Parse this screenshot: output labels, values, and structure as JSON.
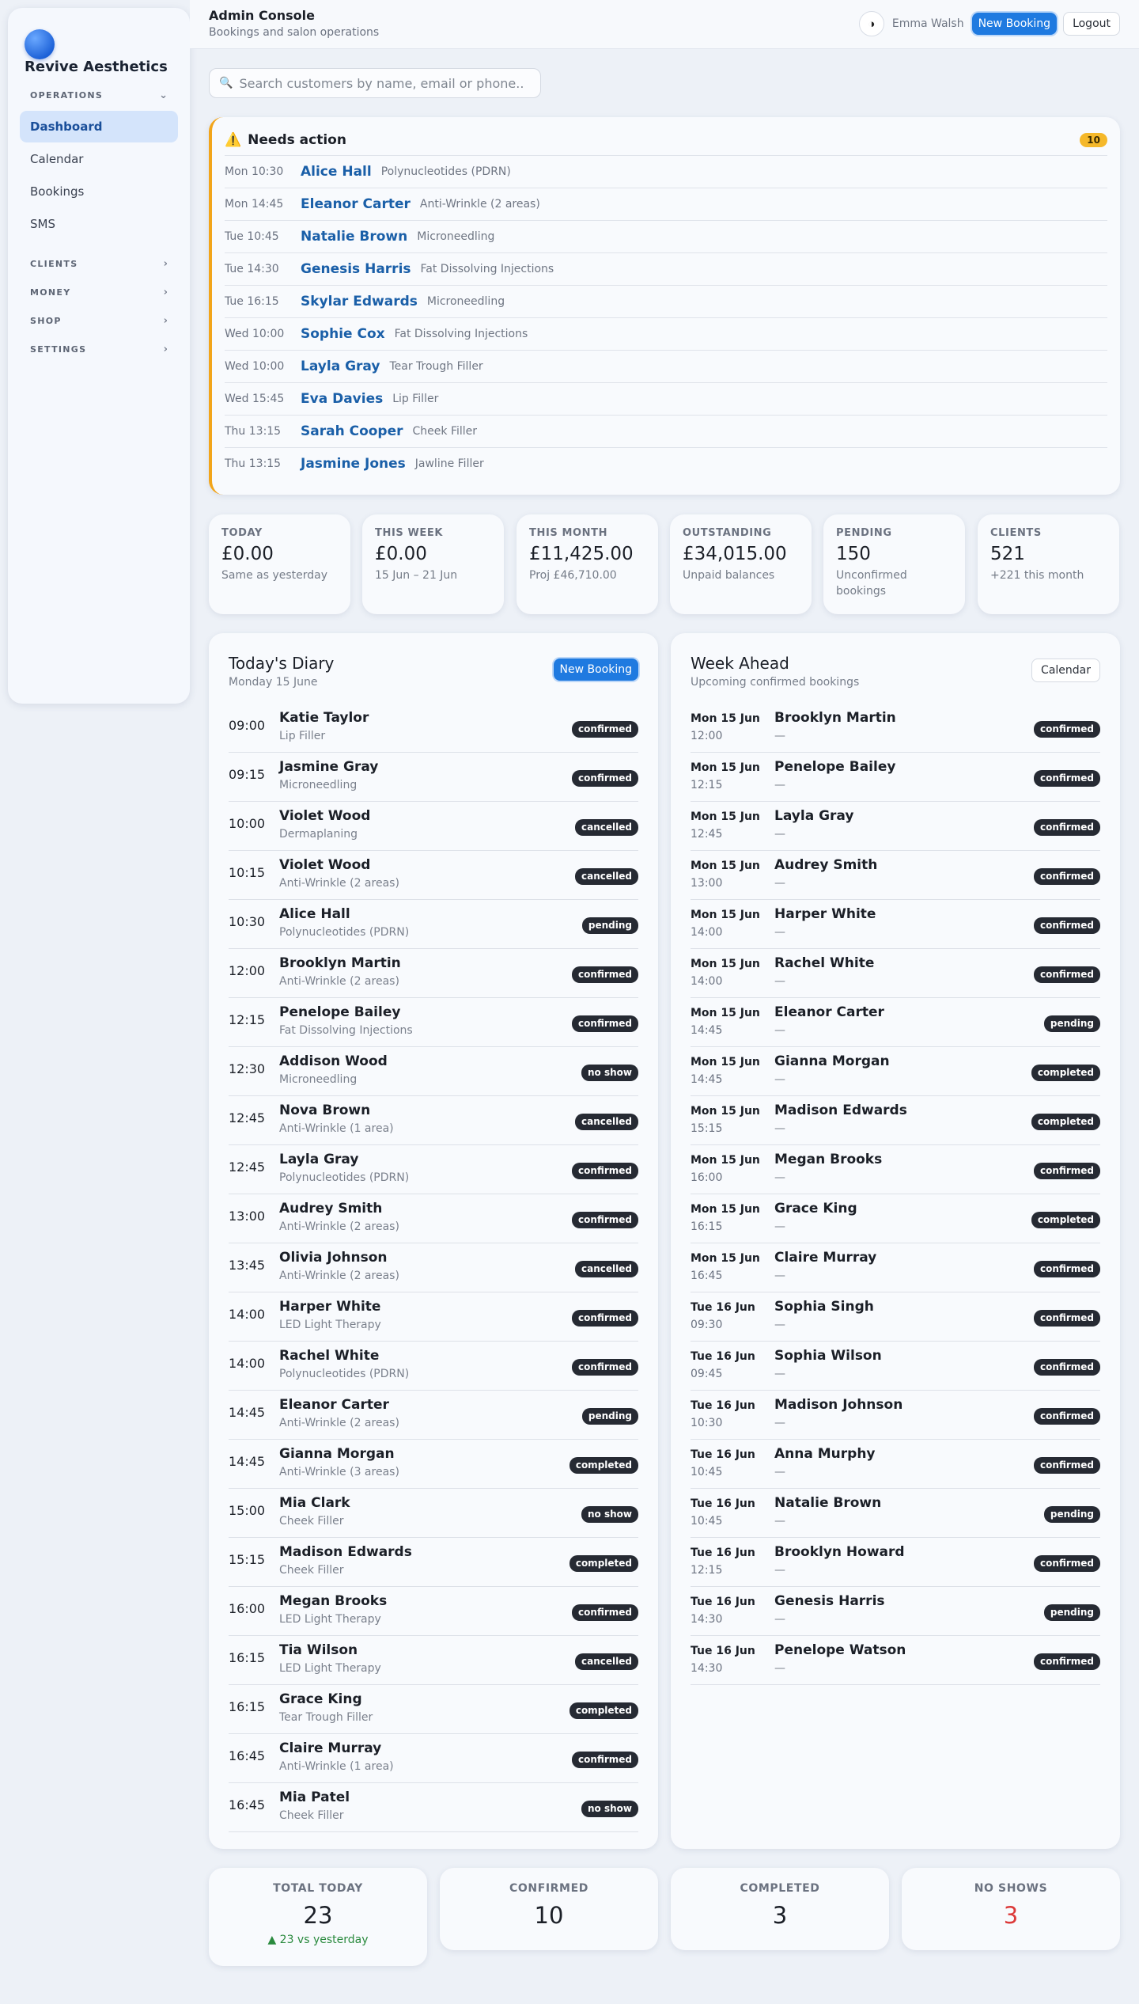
{
  "sidebar": {
    "brand": "Revive Aesthetics",
    "sections": {
      "operations": "OPERATIONS",
      "clients": "CLIENTS",
      "money": "MONEY",
      "shop": "SHOP",
      "settings": "SETTINGS"
    },
    "items": [
      {
        "label": "Dashboard",
        "active": true
      },
      {
        "label": "Calendar"
      },
      {
        "label": "Bookings"
      },
      {
        "label": "SMS"
      }
    ]
  },
  "header": {
    "title": "Admin Console",
    "subtitle": "Bookings and salon operations",
    "user": "Emma Walsh",
    "new_booking": "New Booking",
    "logout": "Logout"
  },
  "search": {
    "placeholder": "Search customers by name, email or phone..."
  },
  "needs_action": {
    "title": "Needs action",
    "count": "10",
    "items": [
      {
        "time": "Mon 10:30",
        "name": "Alice Hall",
        "service": "Polynucleotides (PDRN)"
      },
      {
        "time": "Mon 14:45",
        "name": "Eleanor Carter",
        "service": "Anti-Wrinkle (2 areas)"
      },
      {
        "time": "Tue 10:45",
        "name": "Natalie Brown",
        "service": "Microneedling"
      },
      {
        "time": "Tue 14:30",
        "name": "Genesis Harris",
        "service": "Fat Dissolving Injections"
      },
      {
        "time": "Tue 16:15",
        "name": "Skylar Edwards",
        "service": "Microneedling"
      },
      {
        "time": "Wed 10:00",
        "name": "Sophie Cox",
        "service": "Fat Dissolving Injections"
      },
      {
        "time": "Wed 10:00",
        "name": "Layla Gray",
        "service": "Tear Trough Filler"
      },
      {
        "time": "Wed 15:45",
        "name": "Eva Davies",
        "service": "Lip Filler"
      },
      {
        "time": "Thu 13:15",
        "name": "Sarah Cooper",
        "service": "Cheek Filler"
      },
      {
        "time": "Thu 13:15",
        "name": "Jasmine Jones",
        "service": "Jawline Filler"
      }
    ]
  },
  "stats": [
    {
      "label": "TODAY",
      "value": "£0.00",
      "sub": "Same as yesterday"
    },
    {
      "label": "THIS WEEK",
      "value": "£0.00",
      "sub": "15 Jun – 21 Jun"
    },
    {
      "label": "THIS MONTH",
      "value": "£11,425.00",
      "sub": "Proj £46,710.00"
    },
    {
      "label": "OUTSTANDING",
      "value": "£34,015.00",
      "sub": "Unpaid balances"
    },
    {
      "label": "PENDING",
      "value": "150",
      "sub": "Unconfirmed bookings"
    },
    {
      "label": "CLIENTS",
      "value": "521",
      "sub": "+221 this month"
    }
  ],
  "diary": {
    "title": "Today's Diary",
    "subtitle": "Monday 15 June",
    "button": "New Booking",
    "rows": [
      {
        "time": "09:00",
        "name": "Katie Taylor",
        "service": "Lip Filler",
        "status": "confirmed"
      },
      {
        "time": "09:15",
        "name": "Jasmine Gray",
        "service": "Microneedling",
        "status": "confirmed"
      },
      {
        "time": "10:00",
        "name": "Violet Wood",
        "service": "Dermaplaning",
        "status": "cancelled"
      },
      {
        "time": "10:15",
        "name": "Violet Wood",
        "service": "Anti-Wrinkle (2 areas)",
        "status": "cancelled"
      },
      {
        "time": "10:30",
        "name": "Alice Hall",
        "service": "Polynucleotides (PDRN)",
        "status": "pending"
      },
      {
        "time": "12:00",
        "name": "Brooklyn Martin",
        "service": "Anti-Wrinkle (2 areas)",
        "status": "confirmed"
      },
      {
        "time": "12:15",
        "name": "Penelope Bailey",
        "service": "Fat Dissolving Injections",
        "status": "confirmed"
      },
      {
        "time": "12:30",
        "name": "Addison Wood",
        "service": "Microneedling",
        "status": "no show"
      },
      {
        "time": "12:45",
        "name": "Nova Brown",
        "service": "Anti-Wrinkle (1 area)",
        "status": "cancelled"
      },
      {
        "time": "12:45",
        "name": "Layla Gray",
        "service": "Polynucleotides (PDRN)",
        "status": "confirmed"
      },
      {
        "time": "13:00",
        "name": "Audrey Smith",
        "service": "Anti-Wrinkle (2 areas)",
        "status": "confirmed"
      },
      {
        "time": "13:45",
        "name": "Olivia Johnson",
        "service": "Anti-Wrinkle (2 areas)",
        "status": "cancelled"
      },
      {
        "time": "14:00",
        "name": "Harper White",
        "service": "LED Light Therapy",
        "status": "confirmed"
      },
      {
        "time": "14:00",
        "name": "Rachel White",
        "service": "Polynucleotides (PDRN)",
        "status": "confirmed"
      },
      {
        "time": "14:45",
        "name": "Eleanor Carter",
        "service": "Anti-Wrinkle (2 areas)",
        "status": "pending"
      },
      {
        "time": "14:45",
        "name": "Gianna Morgan",
        "service": "Anti-Wrinkle (3 areas)",
        "status": "completed"
      },
      {
        "time": "15:00",
        "name": "Mia Clark",
        "service": "Cheek Filler",
        "status": "no show"
      },
      {
        "time": "15:15",
        "name": "Madison Edwards",
        "service": "Cheek Filler",
        "status": "completed"
      },
      {
        "time": "16:00",
        "name": "Megan Brooks",
        "service": "LED Light Therapy",
        "status": "confirmed"
      },
      {
        "time": "16:15",
        "name": "Tia Wilson",
        "service": "LED Light Therapy",
        "status": "cancelled"
      },
      {
        "time": "16:15",
        "name": "Grace King",
        "service": "Tear Trough Filler",
        "status": "completed"
      },
      {
        "time": "16:45",
        "name": "Claire Murray",
        "service": "Anti-Wrinkle (1 area)",
        "status": "confirmed"
      },
      {
        "time": "16:45",
        "name": "Mia Patel",
        "service": "Cheek Filler",
        "status": "no show"
      }
    ]
  },
  "week": {
    "title": "Week Ahead",
    "subtitle": "Upcoming confirmed bookings",
    "button": "Calendar",
    "rows": [
      {
        "date": "Mon 15 Jun",
        "time": "12:00",
        "name": "Brooklyn Martin",
        "detail": "—",
        "status": "confirmed"
      },
      {
        "date": "Mon 15 Jun",
        "time": "12:15",
        "name": "Penelope Bailey",
        "detail": "—",
        "status": "confirmed"
      },
      {
        "date": "Mon 15 Jun",
        "time": "12:45",
        "name": "Layla Gray",
        "detail": "—",
        "status": "confirmed"
      },
      {
        "date": "Mon 15 Jun",
        "time": "13:00",
        "name": "Audrey Smith",
        "detail": "—",
        "status": "confirmed"
      },
      {
        "date": "Mon 15 Jun",
        "time": "14:00",
        "name": "Harper White",
        "detail": "—",
        "status": "confirmed"
      },
      {
        "date": "Mon 15 Jun",
        "time": "14:00",
        "name": "Rachel White",
        "detail": "—",
        "status": "confirmed"
      },
      {
        "date": "Mon 15 Jun",
        "time": "14:45",
        "name": "Eleanor Carter",
        "detail": "—",
        "status": "pending"
      },
      {
        "date": "Mon 15 Jun",
        "time": "14:45",
        "name": "Gianna Morgan",
        "detail": "—",
        "status": "completed"
      },
      {
        "date": "Mon 15 Jun",
        "time": "15:15",
        "name": "Madison Edwards",
        "detail": "—",
        "status": "completed"
      },
      {
        "date": "Mon 15 Jun",
        "time": "16:00",
        "name": "Megan Brooks",
        "detail": "—",
        "status": "confirmed"
      },
      {
        "date": "Mon 15 Jun",
        "time": "16:15",
        "name": "Grace King",
        "detail": "—",
        "status": "completed"
      },
      {
        "date": "Mon 15 Jun",
        "time": "16:45",
        "name": "Claire Murray",
        "detail": "—",
        "status": "confirmed"
      },
      {
        "date": "Tue 16 Jun",
        "time": "09:30",
        "name": "Sophia Singh",
        "detail": "—",
        "status": "confirmed"
      },
      {
        "date": "Tue 16 Jun",
        "time": "09:45",
        "name": "Sophia Wilson",
        "detail": "—",
        "status": "confirmed"
      },
      {
        "date": "Tue 16 Jun",
        "time": "10:30",
        "name": "Madison Johnson",
        "detail": "—",
        "status": "confirmed"
      },
      {
        "date": "Tue 16 Jun",
        "time": "10:45",
        "name": "Anna Murphy",
        "detail": "—",
        "status": "confirmed"
      },
      {
        "date": "Tue 16 Jun",
        "time": "10:45",
        "name": "Natalie Brown",
        "detail": "—",
        "status": "pending"
      },
      {
        "date": "Tue 16 Jun",
        "time": "12:15",
        "name": "Brooklyn Howard",
        "detail": "—",
        "status": "confirmed"
      },
      {
        "date": "Tue 16 Jun",
        "time": "14:30",
        "name": "Genesis Harris",
        "detail": "—",
        "status": "pending"
      },
      {
        "date": "Tue 16 Jun",
        "time": "14:30",
        "name": "Penelope Watson",
        "detail": "—",
        "status": "confirmed"
      }
    ]
  },
  "summary": [
    {
      "label": "TOTAL TODAY",
      "value": "23",
      "sub": "▲ 23 vs yesterday"
    },
    {
      "label": "CONFIRMED",
      "value": "10"
    },
    {
      "label": "COMPLETED",
      "value": "3"
    },
    {
      "label": "NO SHOWS",
      "value": "3",
      "alert": true
    }
  ],
  "colors": {
    "accent": "#1f7ae0",
    "warning": "#f2a51a",
    "link": "#1a5fa8",
    "alert": "#dc3a3a",
    "positive": "#2a8a3e"
  },
  "icons": {
    "theme": "contrast-icon",
    "search": "search-icon",
    "warning": "warning-icon",
    "chevron": "chevron-icon"
  }
}
